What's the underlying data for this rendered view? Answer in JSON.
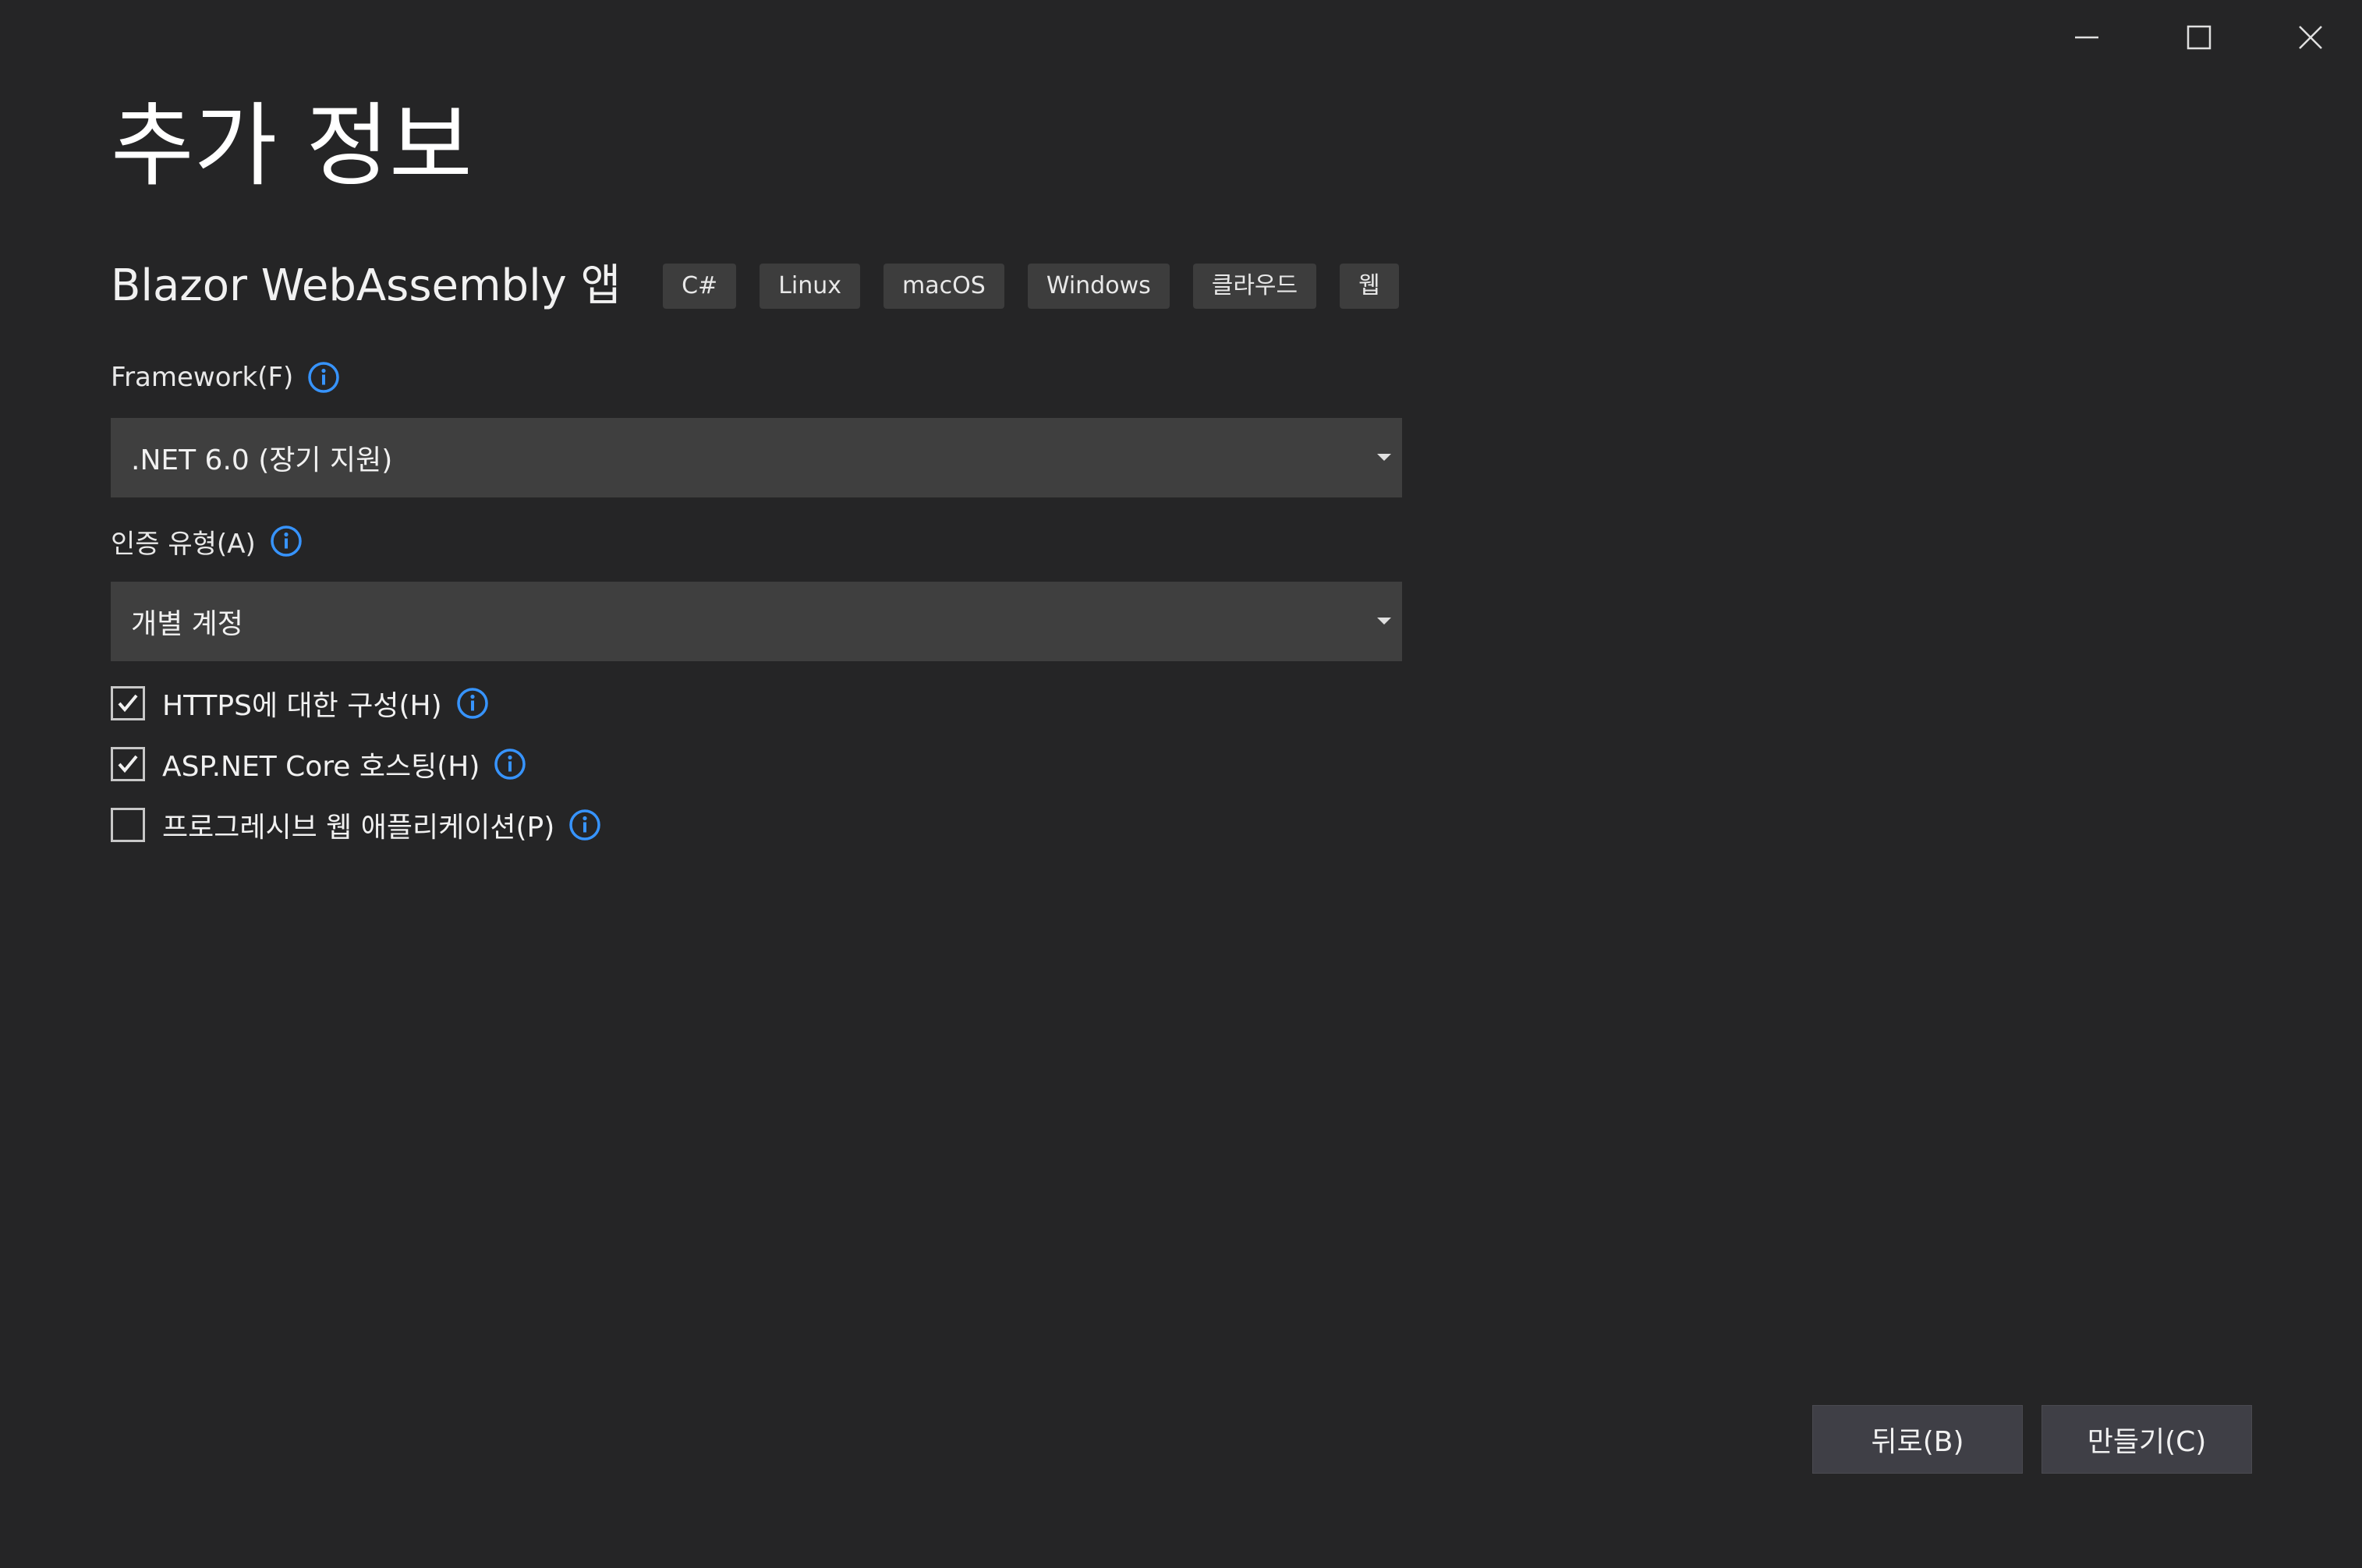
{
  "window": {
    "controls": {
      "minimize_icon": "minimize-icon",
      "maximize_icon": "maximize-icon",
      "close_icon": "close-icon"
    }
  },
  "page": {
    "title": "추가 정보",
    "template_name": "Blazor WebAssembly 앱",
    "tags": [
      "C#",
      "Linux",
      "macOS",
      "Windows",
      "클라우드",
      "웹"
    ]
  },
  "framework": {
    "label": "Framework(F)",
    "value": ".NET 6.0 (장기 지원)"
  },
  "auth": {
    "label": "인증 유형(A)",
    "value": "개별 계정"
  },
  "options": [
    {
      "label": "HTTPS에 대한 구성(H)",
      "checked": true
    },
    {
      "label": "ASP.NET Core 호스팅(H)",
      "checked": true
    },
    {
      "label": "프로그레시브 웹 애플리케이션(P)",
      "checked": false
    }
  ],
  "buttons": {
    "back": "뒤로(B)",
    "create": "만들기(C)"
  },
  "colors": {
    "background": "#252526",
    "info_icon": "#3794ff",
    "select_bg": "#3f3f3f",
    "tag_bg": "#3d3d3d"
  }
}
